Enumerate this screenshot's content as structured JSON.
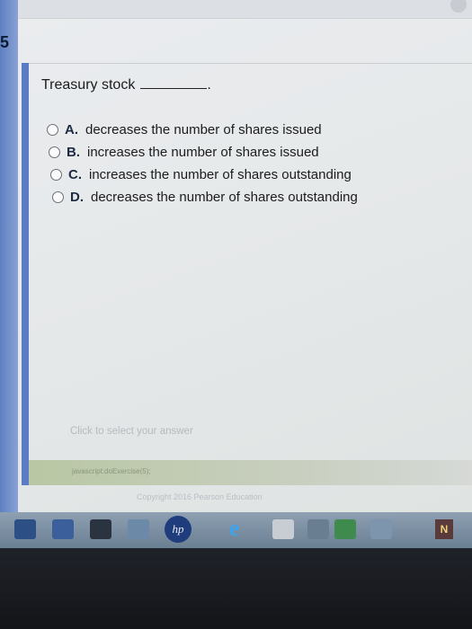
{
  "question": {
    "text": "Treasury stock",
    "blank_suffix": "."
  },
  "options": [
    {
      "letter": "A.",
      "text": "decreases the number of shares issued"
    },
    {
      "letter": "B.",
      "text": "increases the number of shares issued"
    },
    {
      "letter": "C.",
      "text": "increases the number of shares outstanding"
    },
    {
      "letter": "D.",
      "text": "decreases the number of shares outstanding"
    }
  ],
  "hint": "Click to select your answer",
  "status_bar": "javascript:doExercise(5);",
  "copyright": "Copyright 2016 Pearson Education",
  "left_mark": "5",
  "taskbar": {
    "hp_label": "hp",
    "ie_label": "e",
    "n_label": "N"
  },
  "colors": {
    "accent": "#5a7cc4",
    "page_background": "#e6e9ea"
  }
}
